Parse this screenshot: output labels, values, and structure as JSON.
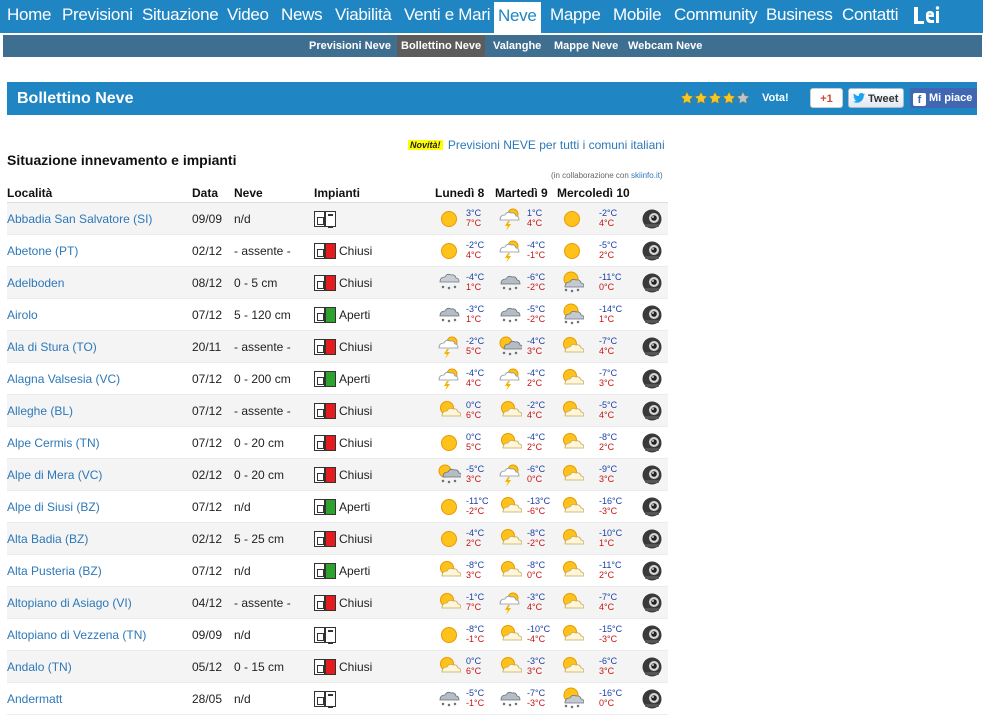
{
  "topnav": {
    "items": [
      "Home",
      "Previsioni",
      "Situazione",
      "Video",
      "News",
      "Viabilità",
      "Venti e Mari",
      "Neve",
      "Mappe",
      "Mobile",
      "Community",
      "Business",
      "Contatti"
    ],
    "active": "Neve"
  },
  "subnav": {
    "items": [
      "Previsioni Neve",
      "Bollettino Neve",
      "Valanghe",
      "Mappe Neve",
      "Webcam Neve"
    ],
    "active": "Bollettino Neve"
  },
  "banner": {
    "title": "Bollettino Neve",
    "rating": 4,
    "vota": "Vota!",
    "gplus": "+1",
    "tweet": "Tweet",
    "fb": "Mi piace"
  },
  "novita": {
    "badge": "Novità!",
    "link": "Previsioni NEVE per tutti i comuni italiani"
  },
  "section_title": "Situazione innevamento e impianti",
  "collab": {
    "text": "(in collaborazione con ",
    "link": "skiinfo.it",
    "close": ")"
  },
  "headers": {
    "loc": "Località",
    "date": "Data",
    "neve": "Neve",
    "imp": "Impianti",
    "d1": "Lunedì 8",
    "d2": "Martedì 9",
    "d3": "Mercoledì 10"
  },
  "colors": {
    "nav": "#1f86c3",
    "subnav": "#3f6f90",
    "link": "#2c78b8",
    "min": "#1a3fa8",
    "max": "#c11111"
  },
  "rows": [
    {
      "loc": "Abbadia San Salvatore (SI)",
      "date": "09/09",
      "neve": "n/d",
      "imp": "n",
      "st": "",
      "w": [
        [
          "sun",
          "3°C",
          "7°C"
        ],
        [
          "storm",
          "1°C",
          "4°C"
        ],
        [
          "sun",
          "-2°C",
          "4°C"
        ]
      ]
    },
    {
      "loc": "Abetone (PT)",
      "date": "02/12",
      "neve": " - assente -",
      "imp": "r",
      "st": "Chiusi",
      "w": [
        [
          "sun",
          "-2°C",
          "4°C"
        ],
        [
          "storm",
          "-4°C",
          "-1°C"
        ],
        [
          "sun",
          "-5°C",
          "2°C"
        ]
      ]
    },
    {
      "loc": "Adelboden",
      "date": "08/12",
      "neve": "0 - 5 cm",
      "imp": "r",
      "st": "Chiusi",
      "w": [
        [
          "snow",
          "-4°C",
          "1°C"
        ],
        [
          "snowcloud",
          "-6°C",
          "-2°C"
        ],
        [
          "sunsnow",
          "-11°C",
          "0°C"
        ]
      ]
    },
    {
      "loc": "Airolo",
      "date": "07/12",
      "neve": "5 - 120 cm",
      "imp": "g",
      "st": "Aperti",
      "w": [
        [
          "snowcloud",
          "-3°C",
          "1°C"
        ],
        [
          "snowcloud",
          "-5°C",
          "-2°C"
        ],
        [
          "sunsnow",
          "-14°C",
          "1°C"
        ]
      ]
    },
    {
      "loc": "Ala di Stura (TO)",
      "date": "20/11",
      "neve": " - assente -",
      "imp": "r",
      "st": "Chiusi",
      "w": [
        [
          "storm",
          "-2°C",
          "5°C"
        ],
        [
          "suncloudsnow",
          "-4°C",
          "3°C"
        ],
        [
          "suncloud",
          "-7°C",
          "4°C"
        ]
      ]
    },
    {
      "loc": "Alagna Valsesia (VC)",
      "date": "07/12",
      "neve": "0 - 200 cm",
      "imp": "g",
      "st": "Aperti",
      "w": [
        [
          "storm",
          "-4°C",
          "4°C"
        ],
        [
          "storm",
          "-4°C",
          "2°C"
        ],
        [
          "suncloud",
          "-7°C",
          "3°C"
        ]
      ]
    },
    {
      "loc": "Alleghe (BL)",
      "date": "07/12",
      "neve": " - assente -",
      "imp": "r",
      "st": "Chiusi",
      "w": [
        [
          "suncloud",
          "0°C",
          "6°C"
        ],
        [
          "suncloud",
          "-2°C",
          "4°C"
        ],
        [
          "suncloud",
          "-5°C",
          "4°C"
        ]
      ]
    },
    {
      "loc": "Alpe Cermis (TN)",
      "date": "07/12",
      "neve": "0 - 20 cm",
      "imp": "r",
      "st": "Chiusi",
      "w": [
        [
          "sun",
          "0°C",
          "5°C"
        ],
        [
          "suncloud",
          "-4°C",
          "2°C"
        ],
        [
          "suncloud",
          "-8°C",
          "2°C"
        ]
      ]
    },
    {
      "loc": "Alpe di Mera (VC)",
      "date": "02/12",
      "neve": "0 - 20 cm",
      "imp": "r",
      "st": "Chiusi",
      "w": [
        [
          "suncloudsnow",
          "-5°C",
          "3°C"
        ],
        [
          "storm",
          "-6°C",
          "0°C"
        ],
        [
          "suncloud",
          "-9°C",
          "3°C"
        ]
      ]
    },
    {
      "loc": "Alpe di Siusi (BZ)",
      "date": "07/12",
      "neve": "n/d",
      "imp": "g",
      "st": "Aperti",
      "w": [
        [
          "sun",
          "-11°C",
          "-2°C"
        ],
        [
          "suncloud",
          "-13°C",
          "-6°C"
        ],
        [
          "suncloud",
          "-16°C",
          "-3°C"
        ]
      ]
    },
    {
      "loc": "Alta Badia (BZ)",
      "date": "02/12",
      "neve": "5 - 25 cm",
      "imp": "r",
      "st": "Chiusi",
      "w": [
        [
          "sun",
          "-4°C",
          "2°C"
        ],
        [
          "suncloud",
          "-8°C",
          "-2°C"
        ],
        [
          "suncloud",
          "-10°C",
          "1°C"
        ]
      ]
    },
    {
      "loc": "Alta Pusteria (BZ)",
      "date": "07/12",
      "neve": "n/d",
      "imp": "g",
      "st": "Aperti",
      "w": [
        [
          "suncloud",
          "-8°C",
          "3°C"
        ],
        [
          "suncloud",
          "-8°C",
          "0°C"
        ],
        [
          "suncloud",
          "-11°C",
          "2°C"
        ]
      ]
    },
    {
      "loc": "Altopiano di Asiago (VI)",
      "date": "04/12",
      "neve": " - assente -",
      "imp": "r",
      "st": "Chiusi",
      "w": [
        [
          "suncloud",
          "-1°C",
          "7°C"
        ],
        [
          "storm",
          "-3°C",
          "4°C"
        ],
        [
          "suncloud",
          "-7°C",
          "4°C"
        ]
      ]
    },
    {
      "loc": "Altopiano di Vezzena (TN)",
      "date": "09/09",
      "neve": "n/d",
      "imp": "n",
      "st": "",
      "w": [
        [
          "sun",
          "-8°C",
          "-1°C"
        ],
        [
          "suncloud",
          "-10°C",
          "-4°C"
        ],
        [
          "suncloud",
          "-15°C",
          "-3°C"
        ]
      ]
    },
    {
      "loc": "Andalo (TN)",
      "date": "05/12",
      "neve": "0 - 15 cm",
      "imp": "r",
      "st": "Chiusi",
      "w": [
        [
          "suncloud",
          "0°C",
          "6°C"
        ],
        [
          "suncloud",
          "-3°C",
          "3°C"
        ],
        [
          "suncloud",
          "-6°C",
          "3°C"
        ]
      ]
    },
    {
      "loc": "Andermatt",
      "date": "28/05",
      "neve": "n/d",
      "imp": "n",
      "st": "",
      "w": [
        [
          "snowcloud",
          "-5°C",
          "-1°C"
        ],
        [
          "snowcloud",
          "-7°C",
          "-3°C"
        ],
        [
          "sunsnow",
          "-16°C",
          "0°C"
        ]
      ]
    }
  ]
}
